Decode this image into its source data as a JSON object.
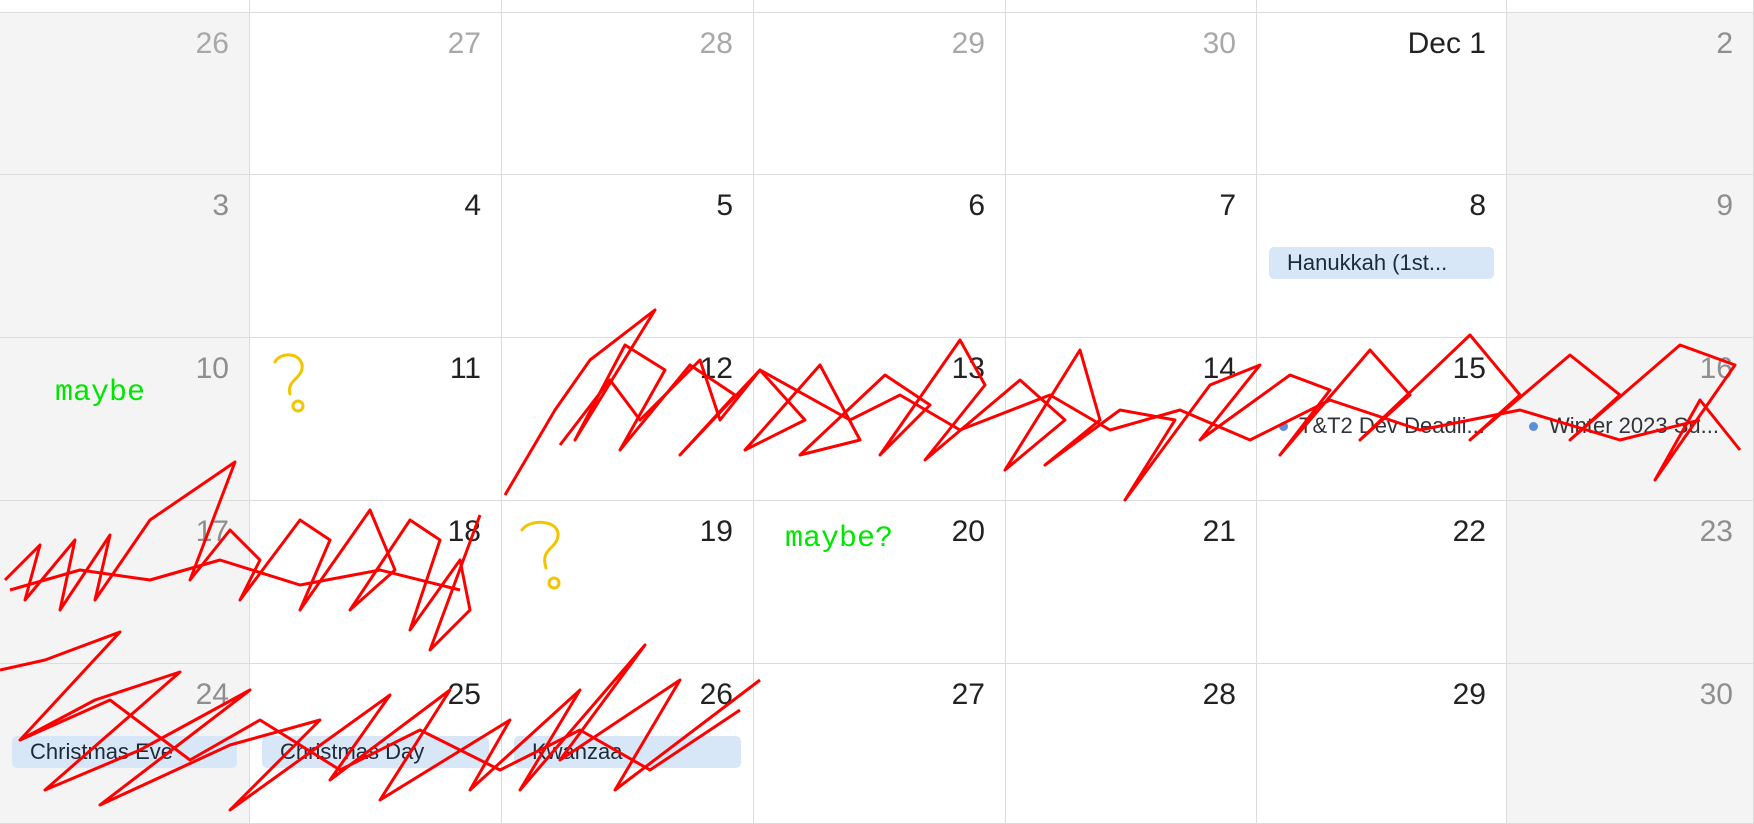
{
  "calendar": {
    "weeks": [
      [
        {
          "day": "26",
          "kind": "dim",
          "weekend": true
        },
        {
          "day": "27",
          "kind": "dim"
        },
        {
          "day": "28",
          "kind": "dim"
        },
        {
          "day": "29",
          "kind": "dim"
        },
        {
          "day": "30",
          "kind": "dim"
        },
        {
          "day": "Dec 1",
          "kind": "normal"
        },
        {
          "day": "2",
          "kind": "weekend",
          "weekend": true
        }
      ],
      [
        {
          "day": "3",
          "kind": "weekend",
          "weekend": true
        },
        {
          "day": "4",
          "kind": "normal"
        },
        {
          "day": "5",
          "kind": "normal"
        },
        {
          "day": "6",
          "kind": "normal"
        },
        {
          "day": "7",
          "kind": "normal"
        },
        {
          "day": "8",
          "kind": "normal",
          "event": "Hanukkah (1st...",
          "event_style": "block"
        },
        {
          "day": "9",
          "kind": "weekend",
          "weekend": true
        }
      ],
      [
        {
          "day": "10",
          "kind": "weekend",
          "weekend": true
        },
        {
          "day": "11",
          "kind": "normal"
        },
        {
          "day": "12",
          "kind": "normal"
        },
        {
          "day": "13",
          "kind": "normal"
        },
        {
          "day": "14",
          "kind": "normal"
        },
        {
          "day": "15",
          "kind": "normal",
          "event": "T&T2 Dev Deadli...",
          "event_style": "dot"
        },
        {
          "day": "16",
          "kind": "weekend",
          "weekend": true,
          "event": "Winter 2023 Su...",
          "event_style": "dot"
        }
      ],
      [
        {
          "day": "17",
          "kind": "weekend",
          "weekend": true
        },
        {
          "day": "18",
          "kind": "normal"
        },
        {
          "day": "19",
          "kind": "normal"
        },
        {
          "day": "20",
          "kind": "normal"
        },
        {
          "day": "21",
          "kind": "normal"
        },
        {
          "day": "22",
          "kind": "normal"
        },
        {
          "day": "23",
          "kind": "weekend",
          "weekend": true
        }
      ],
      [
        {
          "day": "24",
          "kind": "weekend",
          "weekend": true,
          "event": "Christmas Eve",
          "event_style": "block"
        },
        {
          "day": "25",
          "kind": "normal",
          "event": "Christmas Day",
          "event_style": "block"
        },
        {
          "day": "26",
          "kind": "normal",
          "event": "Kwanzaa",
          "event_style": "block"
        },
        {
          "day": "27",
          "kind": "normal"
        },
        {
          "day": "28",
          "kind": "normal"
        },
        {
          "day": "29",
          "kind": "normal"
        },
        {
          "day": "30",
          "kind": "weekend",
          "weekend": true
        }
      ]
    ]
  },
  "annotations": {
    "maybe_1": "maybe",
    "maybe_2": "maybe?"
  },
  "colors": {
    "scribble": "#ff0000",
    "question_mark": "#f2c500",
    "annotation_text": "#00e600",
    "event_bg": "#d7e7f8"
  }
}
